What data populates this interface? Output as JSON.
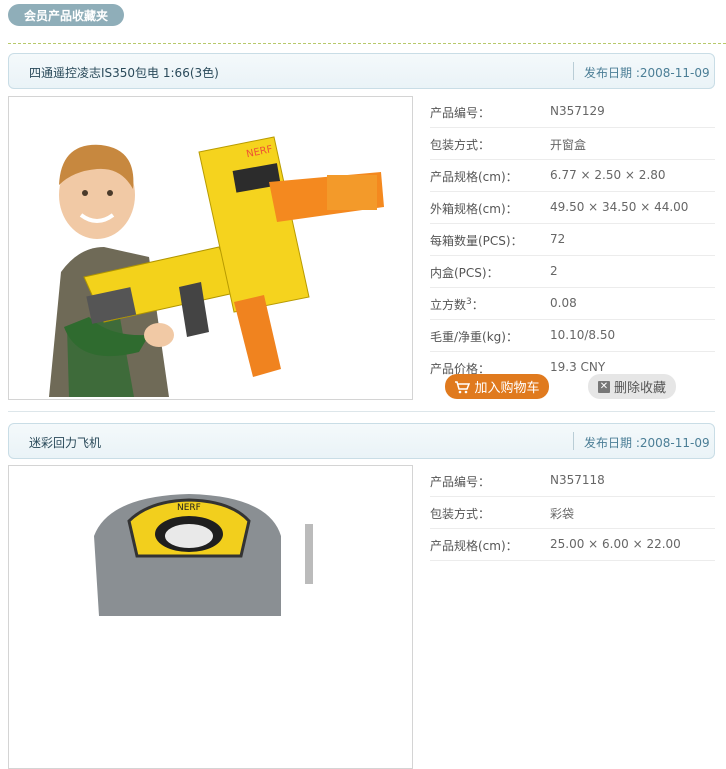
{
  "header": {
    "title": "会员产品收藏夹"
  },
  "products": [
    {
      "name": "四通遥控凌志IS350包电 1:66(3色)",
      "date": "发布日期 :2008-11-09",
      "specs": [
        {
          "label": "产品编号：",
          "value": "N357129"
        },
        {
          "label": "包装方式：",
          "value": "开窗盒"
        },
        {
          "label": "产品规格(cm)：",
          "value": "6.77 × 2.50 × 2.80"
        },
        {
          "label": "外箱规格(cm)：",
          "value": "49.50 × 34.50 × 44.00"
        },
        {
          "label": "每箱数量(PCS)：",
          "value": "72"
        },
        {
          "label": "内盒(PCS)：",
          "value": "2"
        },
        {
          "label": "立方数",
          "sup": "3",
          "label_suffix": "：",
          "value": "0.08"
        },
        {
          "label": "毛重/净重(kg)：",
          "value": "10.10/8.50"
        },
        {
          "label": "产品价格：",
          "value": "19.3 CNY"
        }
      ],
      "add_cart_label": "加入购物车",
      "remove_label": "删除收藏"
    },
    {
      "name": "迷彩回力飞机",
      "date": "发布日期 :2008-11-09",
      "specs": [
        {
          "label": "产品编号：",
          "value": "N357118"
        },
        {
          "label": "包装方式：",
          "value": "彩袋"
        },
        {
          "label": "产品规格(cm)：",
          "value": "25.00 × 6.00 × 22.00"
        }
      ]
    }
  ],
  "colors": {
    "accent": "#e07a1e",
    "pill": "#8faeb9",
    "title_text": "#2a4a5a",
    "date_text": "#4b7e96"
  },
  "icons": {
    "cart": "cart-icon",
    "delete": "close-box-icon"
  }
}
